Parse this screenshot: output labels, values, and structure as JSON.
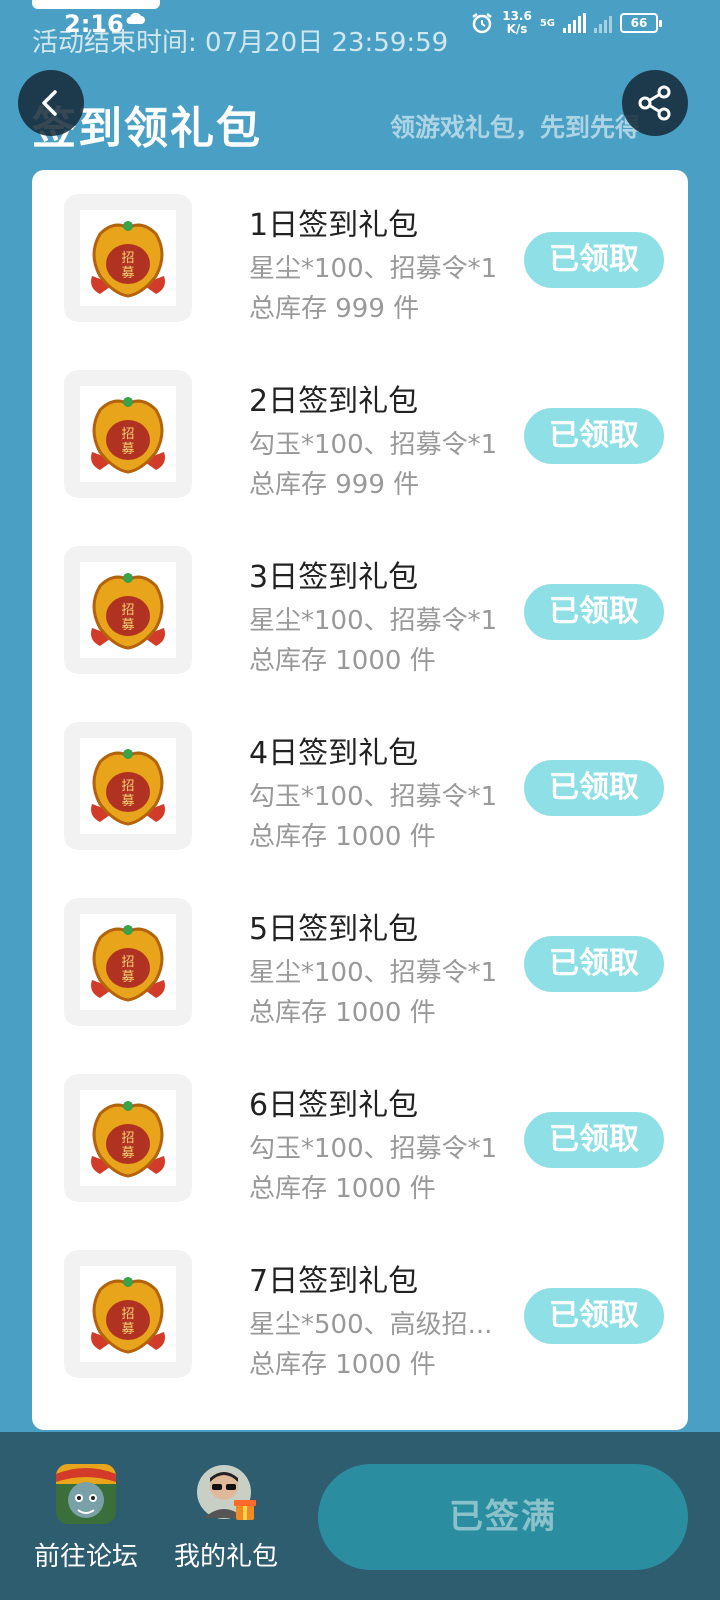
{
  "status_bar": {
    "time": "2:16",
    "net_speed_value": "13.6",
    "net_speed_unit": "K/s",
    "network_type": "5G",
    "battery": "66"
  },
  "activity_end": "活动结束时间: 07月20日 23:59:59",
  "header": {
    "title": "签到领礼包",
    "subtitle": "领游戏礼包，先到先得"
  },
  "gifts": [
    {
      "title": "1日签到礼包",
      "desc": "星尘*100、招募令*1",
      "stock": "总库存 999 件",
      "button": "已领取"
    },
    {
      "title": "2日签到礼包",
      "desc": "勾玉*100、招募令*1",
      "stock": "总库存 999 件",
      "button": "已领取"
    },
    {
      "title": "3日签到礼包",
      "desc": "星尘*100、招募令*1",
      "stock": "总库存 1000 件",
      "button": "已领取"
    },
    {
      "title": "4日签到礼包",
      "desc": "勾玉*100、招募令*1",
      "stock": "总库存 1000 件",
      "button": "已领取"
    },
    {
      "title": "5日签到礼包",
      "desc": "星尘*100、招募令*1",
      "stock": "总库存 1000 件",
      "button": "已领取"
    },
    {
      "title": "6日签到礼包",
      "desc": "勾玉*100、招募令*1",
      "stock": "总库存 1000 件",
      "button": "已领取"
    },
    {
      "title": "7日签到礼包",
      "desc": "星尘*500、高级招...",
      "stock": "总库存 1000 件",
      "button": "已领取"
    }
  ],
  "bottom_bar": {
    "forum_label": "前往论坛",
    "my_gifts_label": "我的礼包",
    "signed_full_label": "已签满"
  },
  "colors": {
    "background": "#4aa0c4",
    "claimed_button": "#8fe0e6",
    "bottom_bar": "#2e5d70",
    "primary_button": "#2a8ea0"
  }
}
